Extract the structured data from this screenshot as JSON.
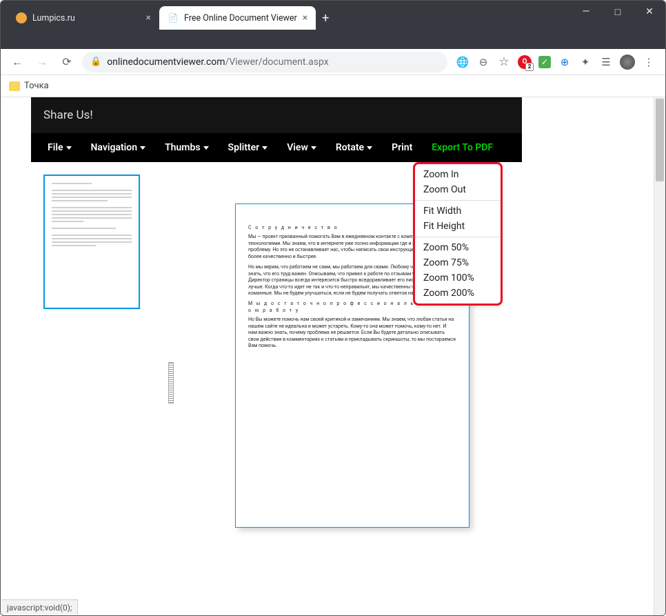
{
  "window": {
    "tabs": [
      {
        "title": "Lumpics.ru",
        "favicon_color": "#f2a93b",
        "active": false
      },
      {
        "title": "Free Online Document Viewer",
        "favicon_glyph": "📄",
        "active": true
      }
    ]
  },
  "address_bar": {
    "domain": "onlinedocumentviewer.com",
    "path": "/Viewer/document.aspx"
  },
  "bookmarks": [
    {
      "label": "Точка"
    }
  ],
  "app": {
    "share_label": "Share Us!",
    "menu": {
      "file": "File",
      "navigation": "Navigation",
      "thumbs": "Thumbs",
      "splitter": "Splitter",
      "view": "View",
      "rotate": "Rotate",
      "print": "Print",
      "export": "Export To PDF"
    },
    "view_dropdown": {
      "zoom_in": "Zoom In",
      "zoom_out": "Zoom Out",
      "fit_width": "Fit Width",
      "fit_height": "Fit Height",
      "zoom_50": "Zoom 50%",
      "zoom_75": "Zoom 75%",
      "zoom_100": "Zoom 100%",
      "zoom_200": "Zoom 200%"
    },
    "document": {
      "heading1": "С о т р у д н и ч е с т в о",
      "para1": "Мы — проект призванный помогать Вам в ежедневном контакте с компьютерными технологиями. Мы знаем, что в интернете уже полно информации где и как решать проблему. Но это не останавливает нас, чтобы написать свои инструкции лучше и задачи более качественно и быстрее.",
      "para2": "Но мы верим, что работаем не сами, мы работаем для свами. Любому человеку важно знать, что его труд важен. Описываем, что привел к работе по отзывам читателей. Директор страницы всегда интересится быстро вседоравливает его писать материально лучше. Когда что-то идет не так и что-то неправильят, мы качественны чтобы связь команные. Мы не будем улучшаться, если не будем получать ответов на работу.",
      "heading2": "М ы   д о с т а т о ч н о   п р о ф е с с и о н а л ь н ы   з а   с в о ю   р а б о т у",
      "para3": "Но Вы можете помочь нам своей критикой и замечаниям. Мы знаем, что любая статья на нашем сайте не идеальна и может устареть. Кому-то она может помочь, кому-то нет. И нам важно знать, почему проблема не решается. Если Вы будете детально описывать свои действия в комментариях к статьям и прикладывать скриншоты, то мы постараемся Вам помочь."
    }
  },
  "status_bar": {
    "text": "javascript:void(0);"
  }
}
